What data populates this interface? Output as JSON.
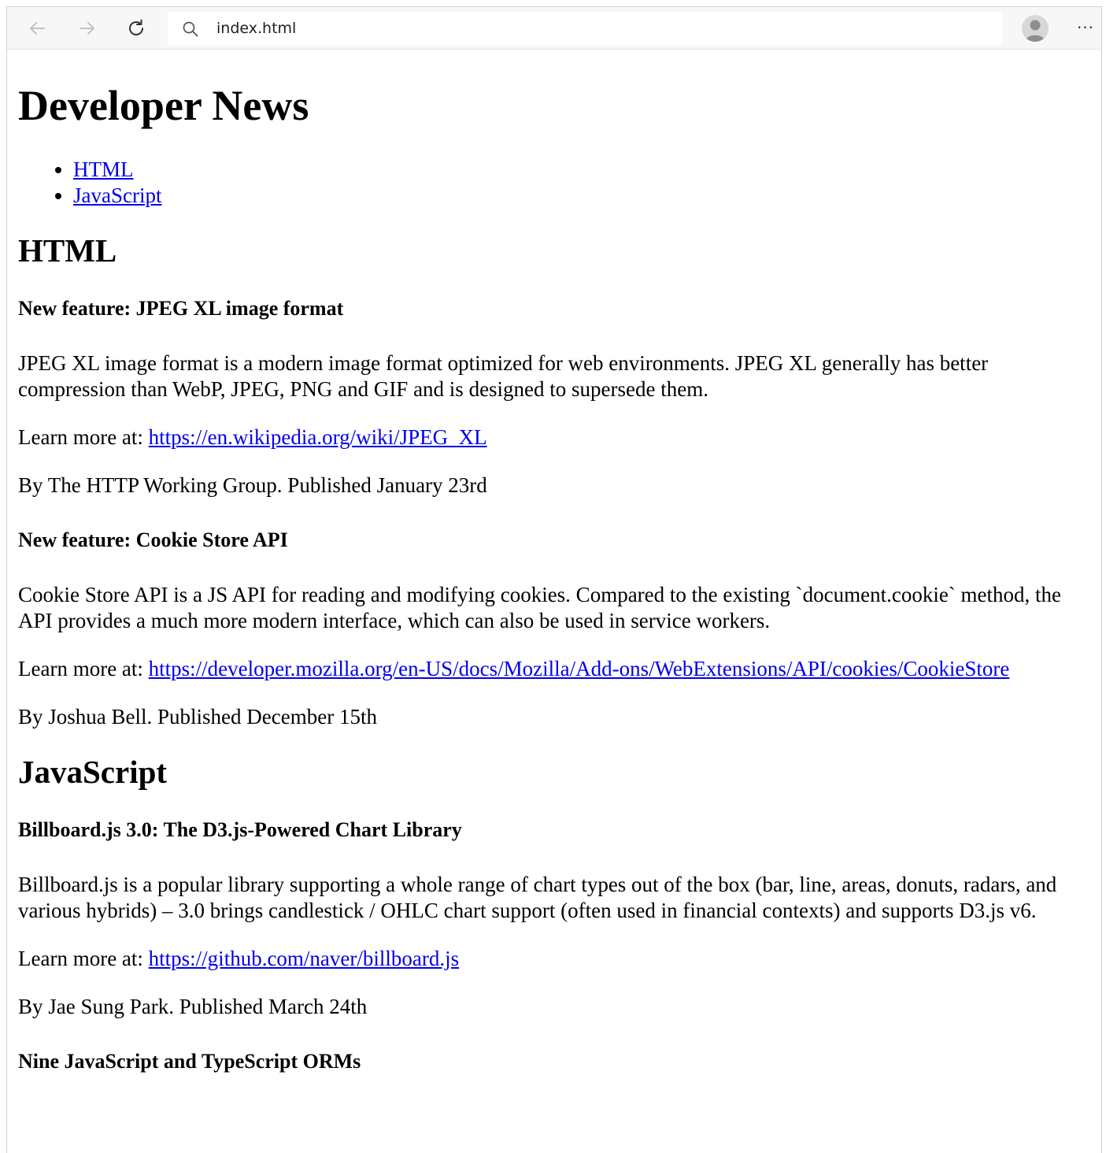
{
  "browser": {
    "address": "index.html",
    "more_label": "···"
  },
  "page": {
    "title": "Developer News",
    "nav": [
      {
        "label": "HTML"
      },
      {
        "label": "JavaScript"
      }
    ],
    "sections": [
      {
        "heading": "HTML",
        "articles": [
          {
            "title": "New feature: JPEG XL image format",
            "body": "JPEG XL image format is a modern image format optimized for web environments. JPEG XL generally has better compression than WebP, JPEG, PNG and GIF and is designed to supersede them.",
            "learn_prefix": "Learn more at: ",
            "link": "https://en.wikipedia.org/wiki/JPEG_XL",
            "byline": "By The HTTP Working Group. Published January 23rd"
          },
          {
            "title": "New feature: Cookie Store API",
            "body": "Cookie Store API is a JS API for reading and modifying cookies. Compared to the existing `document.cookie` method, the API provides a much more modern interface, which can also be used in service workers.",
            "learn_prefix": "Learn more at: ",
            "link": "https://developer.mozilla.org/en-US/docs/Mozilla/Add-ons/WebExtensions/API/cookies/CookieStore",
            "byline": "By Joshua Bell. Published December 15th"
          }
        ]
      },
      {
        "heading": "JavaScript",
        "articles": [
          {
            "title": "Billboard.js 3.0: The D3.js-Powered Chart Library",
            "body": "Billboard.js is a popular library supporting a whole range of chart types out of the box (bar, line, areas, donuts, radars, and various hybrids) – 3.0 brings candlestick / OHLC chart support (often used in financial contexts) and supports D3.js v6.",
            "learn_prefix": "Learn more at: ",
            "link": "https://github.com/naver/billboard.js",
            "byline": "By Jae Sung Park. Published March 24th"
          },
          {
            "title": "Nine JavaScript and TypeScript ORMs"
          }
        ]
      }
    ]
  }
}
